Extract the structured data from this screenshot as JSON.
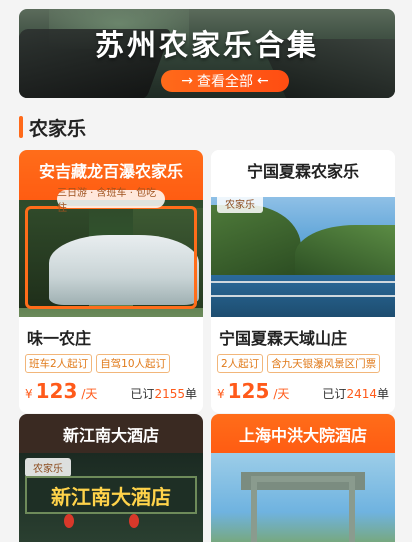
{
  "banner": {
    "title": "苏州农家乐合集",
    "button_label": "查看全部",
    "arrow_left": "→",
    "arrow_right": "←"
  },
  "section": {
    "title": "农家乐"
  },
  "cards": [
    {
      "image_title": "安吉藏龙百瀑农家乐",
      "image_subtitle": "三日游 · 含班车 · 包吃住",
      "name": "味一农庄",
      "chips": [
        "班车2人起订",
        "自驾10人起订"
      ],
      "currency": "¥",
      "price": "123",
      "unit": "/天",
      "sold_prefix": "已订",
      "sold_count": "2155",
      "sold_suffix": "单"
    },
    {
      "image_title": "宁国夏霖农家乐",
      "image_tag": "农家乐",
      "name": "宁国夏霖天域山庄",
      "chips": [
        "2人起订",
        "含九天银瀑风景区门票"
      ],
      "currency": "¥",
      "price": "125",
      "unit": "/天",
      "sold_prefix": "已订",
      "sold_count": "2414",
      "sold_suffix": "单"
    },
    {
      "image_title": "新江南大酒店",
      "image_tag": "农家乐",
      "image_sign": "新江南大酒店"
    },
    {
      "image_title": "上海中洪大院酒店"
    }
  ],
  "colors": {
    "accent": "#ff5a1a",
    "chip_border": "#f2b67a",
    "background": "#f4f4f4"
  }
}
